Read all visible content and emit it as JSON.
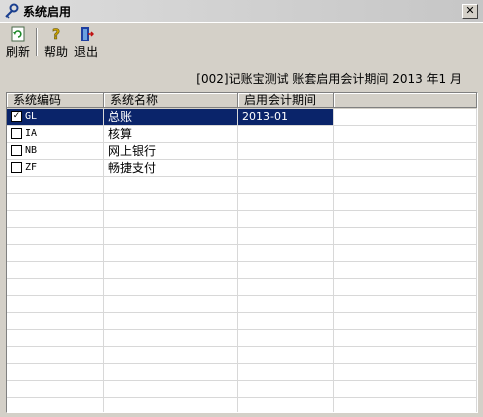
{
  "window": {
    "title": "系统启用"
  },
  "toolbar": {
    "refresh_label": "刷新",
    "help_label": "帮助",
    "exit_label": "退出"
  },
  "info_text": "[002]记账宝测试 账套启用会计期间 2013 年1 月",
  "table": {
    "columns": [
      "系统编码",
      "系统名称",
      "启用会计期间"
    ],
    "rows": [
      {
        "code": "GL",
        "name": "总账",
        "period": "2013-01",
        "checked": true
      },
      {
        "code": "IA",
        "name": "核算",
        "period": "",
        "checked": false
      },
      {
        "code": "NB",
        "name": "网上银行",
        "period": "",
        "checked": false
      },
      {
        "code": "ZF",
        "name": "畅捷支付",
        "period": "",
        "checked": false
      }
    ]
  },
  "colors": {
    "selection": "#0a246a",
    "chrome": "#d4d0c8"
  }
}
